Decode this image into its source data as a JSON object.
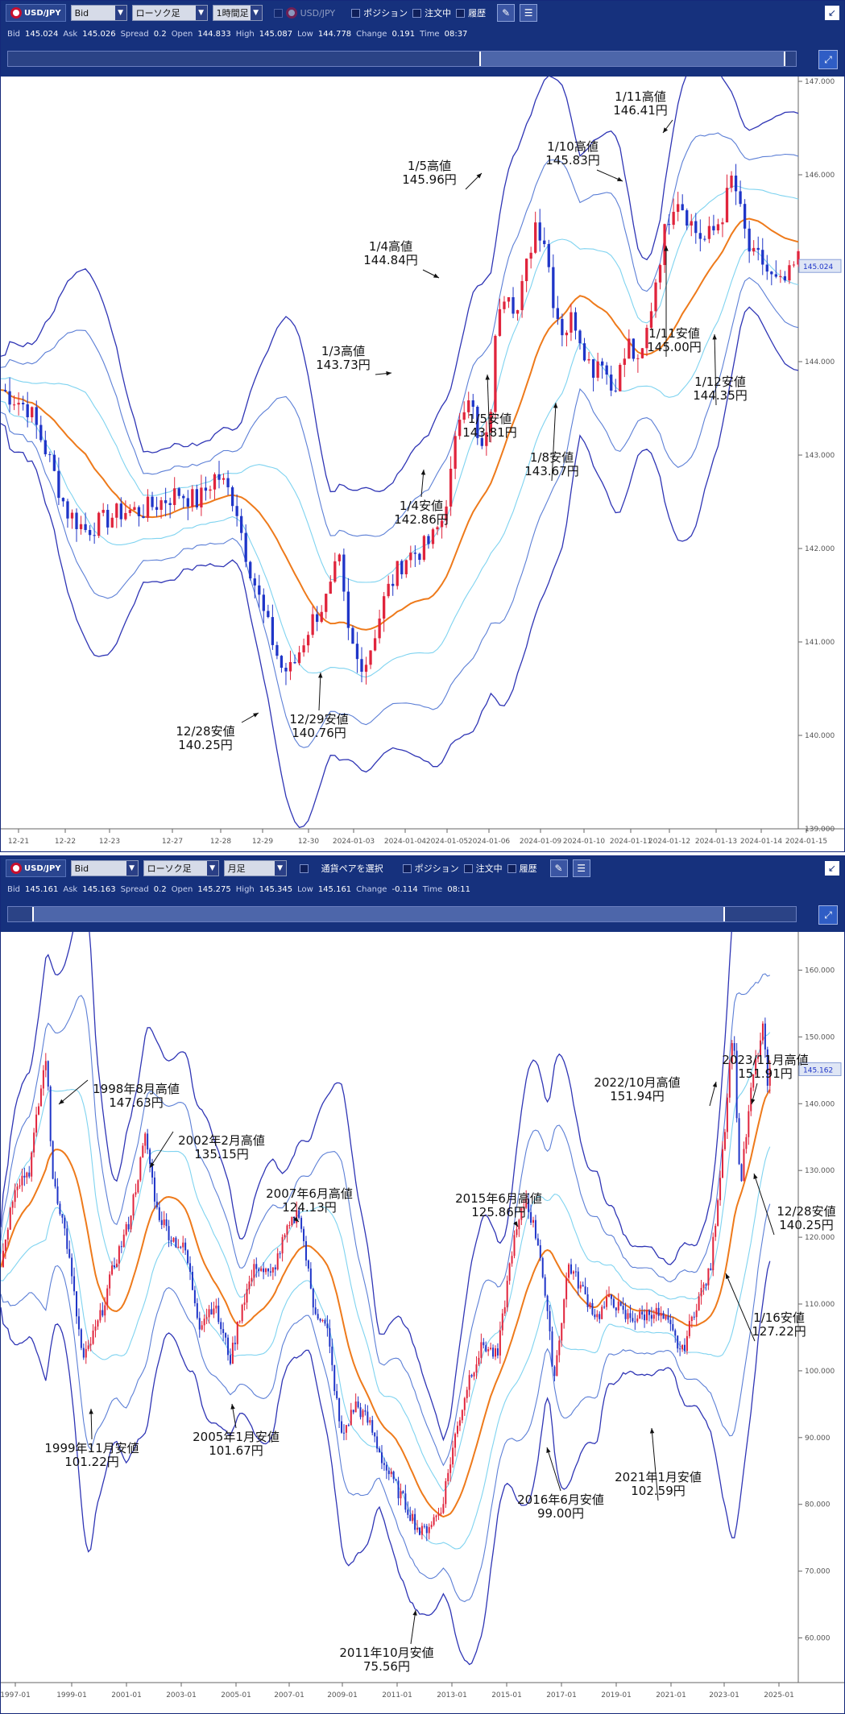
{
  "panels": [
    {
      "toolbar": {
        "pair": "USD/JPY",
        "price_type": "Bid",
        "chart_type": "ローソク足",
        "timeframe": "1時間足",
        "pair2": "USD/JPY",
        "cb_position": "ポジション",
        "cb_order": "注文中",
        "cb_history": "履歴"
      },
      "info": {
        "bid_label": "Bid",
        "bid": "145.024",
        "ask_label": "Ask",
        "ask": "145.026",
        "spread_label": "Spread",
        "spread": "0.2",
        "open_label": "Open",
        "open": "144.833",
        "high_label": "High",
        "high": "145.087",
        "low_label": "Low",
        "low": "144.778",
        "change_label": "Change",
        "change": "0.191",
        "time_label": "Time",
        "time": "08:37"
      }
    },
    {
      "toolbar": {
        "pair": "USD/JPY",
        "price_type": "Bid",
        "chart_type": "ローソク足",
        "timeframe": "月足",
        "select_pair": "通貨ペアを選択",
        "cb_position": "ポジション",
        "cb_order": "注文中",
        "cb_history": "履歴"
      },
      "info": {
        "bid_label": "Bid",
        "bid": "145.161",
        "ask_label": "Ask",
        "ask": "145.163",
        "spread_label": "Spread",
        "spread": "0.2",
        "open_label": "Open",
        "open": "145.275",
        "high_label": "High",
        "high": "145.345",
        "low_label": "Low",
        "low": "145.161",
        "change_label": "Change",
        "change": "-0.114",
        "time_label": "Time",
        "time": "08:11"
      }
    }
  ],
  "chart_data": [
    {
      "type": "line",
      "ylim": [
        139,
        147
      ],
      "yticks": [
        "147.000",
        "146.000",
        "145.000",
        "144.000",
        "143.000",
        "142.000",
        "141.000",
        "140.000",
        "139.000"
      ],
      "current_price": "145.024",
      "xticks": [
        "12-21",
        "12-22",
        "12-23",
        "12-27",
        "12-28",
        "12-29",
        "12-30",
        "2024-01-03",
        "2024-01-04",
        "2024-01-05",
        "2024-01-06",
        "2024-01-09",
        "2024-01-10",
        "2024-01-11",
        "2024-01-12",
        "2024-01-13",
        "2024-01-14",
        "2024-01-15"
      ],
      "price_path": [
        [
          0,
          143.7
        ],
        [
          3,
          143.5
        ],
        [
          5,
          143.0
        ],
        [
          7,
          142.4
        ],
        [
          9,
          142.2
        ],
        [
          11,
          142.3
        ],
        [
          13,
          142.4
        ],
        [
          15,
          142.4
        ],
        [
          17,
          142.5
        ],
        [
          19,
          142.6
        ],
        [
          21,
          142.5
        ],
        [
          23,
          142.8
        ],
        [
          25,
          142.5
        ],
        [
          26,
          142.0
        ],
        [
          28,
          141.3
        ],
        [
          30,
          140.7
        ],
        [
          31,
          140.7
        ],
        [
          33,
          141.2
        ],
        [
          35,
          141.5
        ],
        [
          36,
          141.9
        ],
        [
          37,
          141.1
        ],
        [
          38,
          140.8
        ],
        [
          39,
          140.8
        ],
        [
          41,
          141.5
        ],
        [
          43,
          141.9
        ],
        [
          45,
          142.0
        ],
        [
          46,
          142.1
        ],
        [
          47,
          142.3
        ],
        [
          48,
          142.8
        ],
        [
          49,
          143.5
        ],
        [
          50,
          143.7
        ],
        [
          51,
          143.0
        ],
        [
          52,
          143.2
        ],
        [
          53,
          144.6
        ],
        [
          54,
          144.84
        ],
        [
          55,
          144.5
        ],
        [
          56,
          145.0
        ],
        [
          57,
          145.5
        ],
        [
          58,
          145.3
        ],
        [
          59,
          144.6
        ],
        [
          60,
          144.3
        ],
        [
          61,
          144.5
        ],
        [
          62,
          144.2
        ],
        [
          63,
          143.9
        ],
        [
          64,
          144.1
        ],
        [
          65,
          143.7
        ],
        [
          66,
          143.9
        ],
        [
          67,
          144.2
        ],
        [
          68,
          143.9
        ],
        [
          69,
          144.4
        ],
        [
          70,
          145.0
        ],
        [
          71,
          145.5
        ],
        [
          72,
          145.8
        ],
        [
          73,
          145.6
        ],
        [
          74,
          145.4
        ],
        [
          75,
          145.3
        ],
        [
          76,
          145.4
        ],
        [
          77,
          145.6
        ],
        [
          78,
          146.0
        ],
        [
          79,
          145.5
        ],
        [
          80,
          145.1
        ],
        [
          81,
          145.1
        ],
        [
          82,
          144.9
        ],
        [
          83,
          144.8
        ],
        [
          84,
          144.9
        ],
        [
          85,
          145.1
        ]
      ],
      "annotations": [
        {
          "label": "1/11高値",
          "value": "146.41円"
        },
        {
          "label": "1/10高値",
          "value": "145.83円"
        },
        {
          "label": "1/5高値",
          "value": "145.96円"
        },
        {
          "label": "1/4高値",
          "value": "144.84円"
        },
        {
          "label": "1/3高値",
          "value": "143.73円"
        },
        {
          "label": "1/11安値",
          "value": "145.00円"
        },
        {
          "label": "1/12安値",
          "value": "144.35円"
        },
        {
          "label": "1/5安値",
          "value": "143.81円"
        },
        {
          "label": "1/8安値",
          "value": "143.67円"
        },
        {
          "label": "1/4安値",
          "value": "142.86円"
        },
        {
          "label": "12/29安値",
          "value": "140.76円"
        },
        {
          "label": "12/28安値",
          "value": "140.25円"
        }
      ]
    },
    {
      "type": "line",
      "ylim": [
        55,
        165
      ],
      "yticks": [
        "160.000",
        "150.000",
        "140.000",
        "130.000",
        "120.000",
        "110.000",
        "100.000",
        "90.000",
        "80.000",
        "70.000",
        "60.000"
      ],
      "current_price": "145.162",
      "xticks": [
        "1997-01",
        "1999-01",
        "2001-01",
        "2003-01",
        "2005-01",
        "2007-01",
        "2009-01",
        "2011-01",
        "2013-01",
        "2015-01",
        "2017-01",
        "2019-01",
        "2021-01",
        "2023-01",
        "2025-01"
      ],
      "price_path": [
        [
          1997.0,
          116
        ],
        [
          1997.5,
          128
        ],
        [
          1998.0,
          130
        ],
        [
          1998.6,
          147.63
        ],
        [
          1998.8,
          130
        ],
        [
          1999.3,
          120
        ],
        [
          1999.9,
          101.22
        ],
        [
          2000.5,
          108
        ],
        [
          2001.0,
          116
        ],
        [
          2001.5,
          122
        ],
        [
          2002.1,
          135.15
        ],
        [
          2002.5,
          124
        ],
        [
          2003.0,
          120
        ],
        [
          2003.5,
          118
        ],
        [
          2004.0,
          107
        ],
        [
          2004.5,
          110
        ],
        [
          2005.1,
          101.67
        ],
        [
          2005.5,
          110
        ],
        [
          2006.0,
          116
        ],
        [
          2006.5,
          114
        ],
        [
          2007.0,
          120
        ],
        [
          2007.5,
          124.13
        ],
        [
          2008.0,
          110
        ],
        [
          2008.5,
          106
        ],
        [
          2009.0,
          90
        ],
        [
          2009.5,
          95
        ],
        [
          2010.0,
          92
        ],
        [
          2010.5,
          86
        ],
        [
          2011.0,
          82
        ],
        [
          2011.8,
          75.56
        ],
        [
          2012.5,
          79
        ],
        [
          2013.0,
          90
        ],
        [
          2013.5,
          99
        ],
        [
          2014.0,
          104
        ],
        [
          2014.5,
          102
        ],
        [
          2015.0,
          118
        ],
        [
          2015.5,
          125.86
        ],
        [
          2016.0,
          118
        ],
        [
          2016.5,
          99.0
        ],
        [
          2017.0,
          116
        ],
        [
          2017.5,
          112
        ],
        [
          2018.0,
          108
        ],
        [
          2018.5,
          111
        ],
        [
          2019.0,
          108
        ],
        [
          2019.5,
          108
        ],
        [
          2020.0,
          109
        ],
        [
          2020.5,
          107
        ],
        [
          2021.0,
          102.59
        ],
        [
          2021.5,
          110
        ],
        [
          2022.0,
          115
        ],
        [
          2022.5,
          136
        ],
        [
          2022.8,
          151.94
        ],
        [
          2023.05,
          127.22
        ],
        [
          2023.5,
          144
        ],
        [
          2023.9,
          151.91
        ],
        [
          2024.0,
          141
        ],
        [
          2024.1,
          145.16
        ]
      ],
      "annotations": [
        {
          "label": "1998年8月高値",
          "value": "147.63円"
        },
        {
          "label": "2002年2月高値",
          "value": "135.15円"
        },
        {
          "label": "2007年6月高値",
          "value": "124.13円"
        },
        {
          "label": "2015年6月高値",
          "value": "125.86円"
        },
        {
          "label": "2022/10月高値",
          "value": "151.94円"
        },
        {
          "label": "2023/11月高値",
          "value": "151.91円"
        },
        {
          "label": "12/28安値",
          "value": "140.25円"
        },
        {
          "label": "1/16安値",
          "value": "127.22円"
        },
        {
          "label": "1999年11月安値",
          "value": "101.22円"
        },
        {
          "label": "2005年1月安値",
          "value": "101.67円"
        },
        {
          "label": "2016年6月安値",
          "value": "99.00円"
        },
        {
          "label": "2021年1月安値",
          "value": "102.59円"
        },
        {
          "label": "2011年10月安値",
          "value": "75.56円"
        }
      ]
    }
  ]
}
